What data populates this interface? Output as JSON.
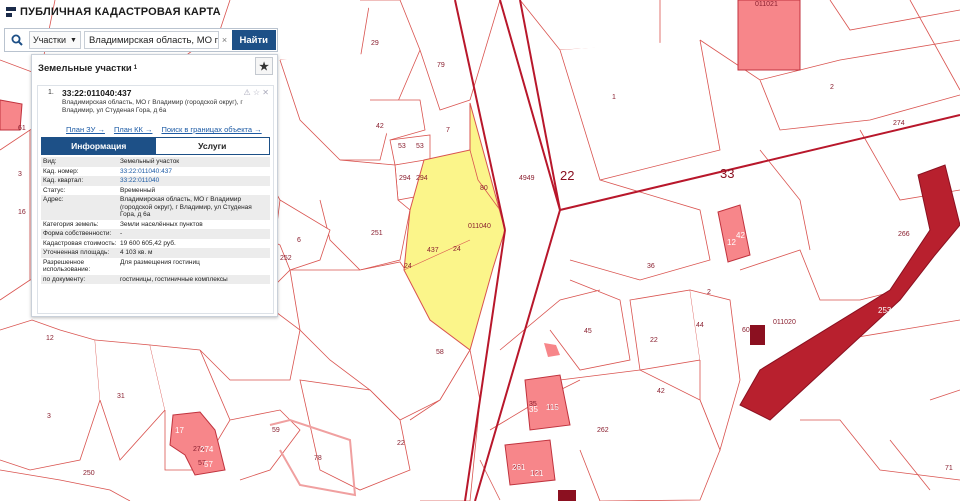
{
  "app": {
    "title": "ПУБЛИЧНАЯ КАДАСТРОВАЯ КАРТА"
  },
  "search": {
    "type_label": "Участки",
    "query": "Владимирская область, МО г Вл",
    "clear_symbol": "×",
    "button_label": "Найти"
  },
  "panel": {
    "title": "Земельные участки",
    "count": "1",
    "item": {
      "index": "1.",
      "cad_number": "33:22:011040:437",
      "address": "Владимирская область, МО г Владимир (городской округ), г Владимир, ул Студеная Гора, д 6а",
      "links": [
        "План ЗУ →",
        "План КК →",
        "Поиск в границах объекта →"
      ],
      "tabs": [
        "Информация",
        "Услуги"
      ],
      "active_tab": 0,
      "attributes": [
        {
          "label": "Вид:",
          "value": "Земельный участок"
        },
        {
          "label": "Кад. номер:",
          "value": "33:22:011040:437",
          "link": true
        },
        {
          "label": "Кад. квартал:",
          "value": "33:22:011040",
          "link": true
        },
        {
          "label": "Статус:",
          "value": "Временный"
        },
        {
          "label": "Адрес:",
          "value": "Владимирская область, МО г Владимир (городской округ), г Владимир, ул Студеная Гора, д 6а"
        },
        {
          "label": "Категория земель:",
          "value": "Земли населённых пунктов"
        },
        {
          "label": "Форма собственности:",
          "value": "-"
        },
        {
          "label": "Кадастровая стоимость:",
          "value": "19 600 605,42 руб."
        },
        {
          "label": "Уточненная площадь:",
          "value": "4 103 кв. м"
        },
        {
          "label": "Разрешенное использование:",
          "value": "Для размещения гостиниц"
        },
        {
          "label": "по документу:",
          "value": "гостиницы, гостиничные комплексы"
        }
      ]
    }
  },
  "map": {
    "highlight_color": "#fbf58a",
    "boundary_color": "#d9534f",
    "block_color": "#b8172b",
    "building_color": "#f7868a",
    "quarter_labels": [
      "22",
      "33"
    ],
    "block_labels": [
      "011040",
      "011020",
      "011021"
    ],
    "selected_parcel_labels": [
      "437",
      "24",
      "80",
      "24"
    ],
    "parcel_labels": [
      "29",
      "79",
      "42",
      "7",
      "53",
      "53",
      "294",
      "294",
      "251",
      "6",
      "252",
      "4949",
      "2",
      "1",
      "274",
      "36",
      "266",
      "44",
      "45",
      "22",
      "42",
      "2",
      "60",
      "12",
      "31",
      "3",
      "17",
      "274",
      "57",
      "78",
      "59",
      "22",
      "58",
      "262",
      "35",
      "115",
      "261",
      "121",
      "250",
      "71",
      "8",
      "61",
      "3",
      "16"
    ],
    "building_labels": [
      "12",
      "42",
      "35",
      "115",
      "261",
      "121",
      "17",
      "274",
      "57",
      "253"
    ]
  }
}
